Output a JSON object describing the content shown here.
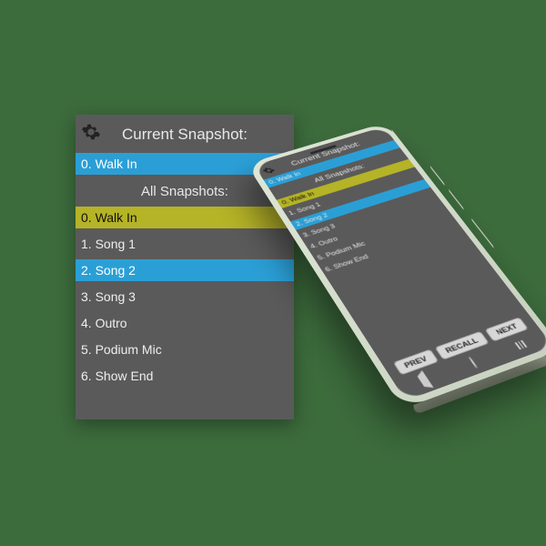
{
  "panel": {
    "title": "Current Snapshot:",
    "current": "0. Walk In",
    "subtitle": "All Snapshots:",
    "items": [
      {
        "label": "0. Walk In",
        "hl": "yellow"
      },
      {
        "label": "1. Song 1",
        "hl": ""
      },
      {
        "label": "2. Song 2",
        "hl": "blue"
      },
      {
        "label": "3. Song 3",
        "hl": ""
      },
      {
        "label": "4. Outro",
        "hl": ""
      },
      {
        "label": "5. Podium Mic",
        "hl": ""
      },
      {
        "label": "6. Show End",
        "hl": ""
      }
    ]
  },
  "phone": {
    "title": "Current Snapshot:",
    "current": "0. Walk In",
    "subtitle": "All Snapshots:",
    "items": [
      {
        "label": "0. Walk In",
        "hl": "yellow"
      },
      {
        "label": "1. Song 1",
        "hl": ""
      },
      {
        "label": "2. Song 2",
        "hl": "blue"
      },
      {
        "label": "3. Song 3",
        "hl": ""
      },
      {
        "label": "4. Outro",
        "hl": ""
      },
      {
        "label": "5. Podium Mic",
        "hl": ""
      },
      {
        "label": "6. Show End",
        "hl": ""
      }
    ],
    "buttons": {
      "prev": "PREV",
      "recall": "RECALL",
      "next": "NEXT"
    }
  },
  "colors": {
    "accent_blue": "#2a9fd6",
    "accent_yellow": "#b5b326",
    "panel_bg": "#5a5a5a"
  }
}
